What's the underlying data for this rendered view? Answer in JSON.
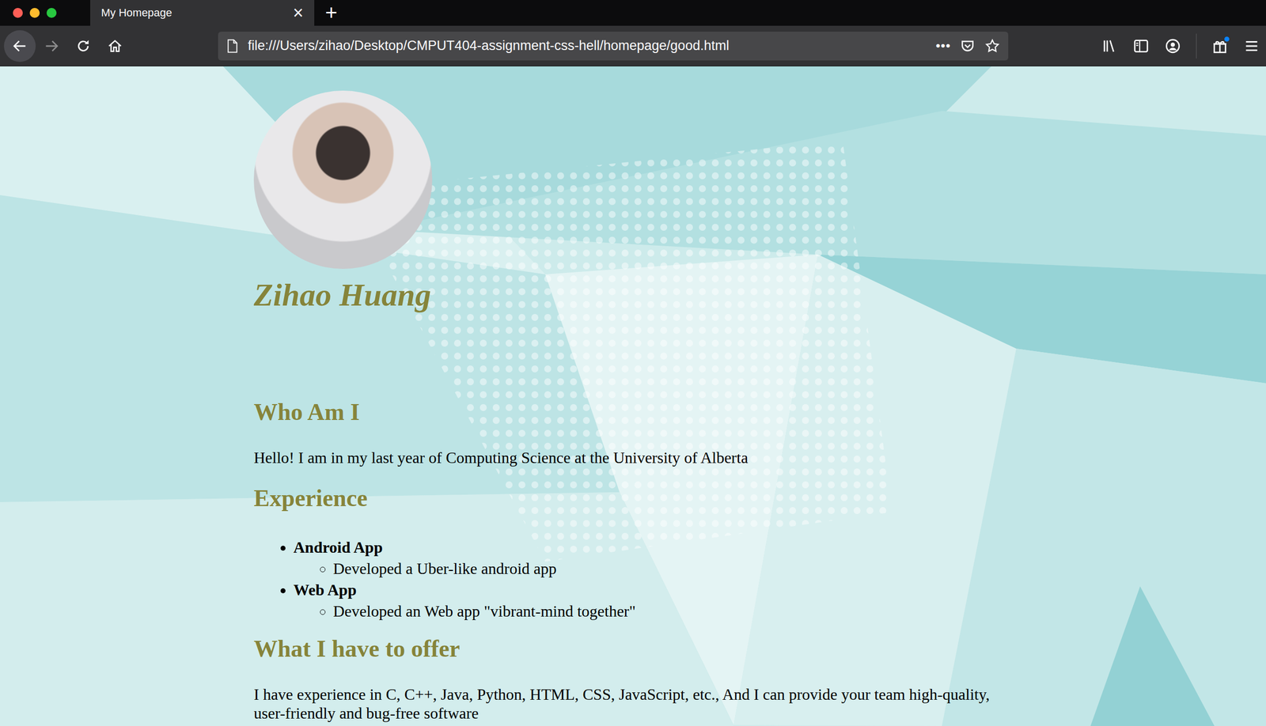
{
  "tabs": [
    {
      "label": "My Homepage",
      "selected": true,
      "close": "×"
    }
  ],
  "new_tab": "+",
  "toolbar": {
    "back_disabled": false,
    "forward_disabled": true
  },
  "address_bar": {
    "url": "file:///Users/zihao/Desktop/CMPUT404-assignment-css-hell/homepage/good.html",
    "actions": "•••"
  },
  "page": {
    "name": "Zihao Huang",
    "sections": [
      {
        "kind": "paragraph",
        "heading": "Who Am I",
        "text": "Hello! I am in my last year of Computing Science at the University of Alberta"
      },
      {
        "kind": "list",
        "heading": "Experience",
        "items": [
          {
            "title": "Android App",
            "details": [
              "Developed a Uber-like android app"
            ]
          },
          {
            "title": "Web App",
            "details": [
              "Developed an Web app \"vibrant-mind together\""
            ]
          }
        ]
      },
      {
        "kind": "paragraph",
        "heading": "What I have to offer",
        "text": "I have experience in C, C++, Java, Python, HTML, CSS, JavaScript, etc., And I can provide your team high-quality, user-friendly and bug-free software"
      }
    ]
  }
}
